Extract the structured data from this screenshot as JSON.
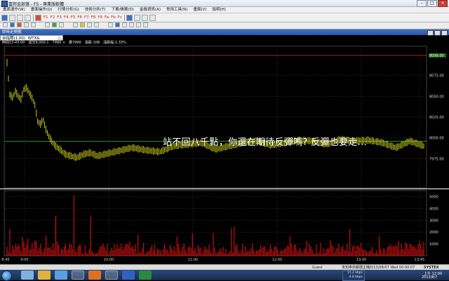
{
  "window": {
    "title": "富邦金部落 - FS - 專業版軟體"
  },
  "menu": [
    "畫面運作(W)",
    "畫面操作(Q)",
    "行情分析(G)",
    "技術分析(T)",
    "下單/帳務(D)",
    "金融資訊(A)",
    "常用工具(N)",
    "畫面(V)",
    "說明(H)"
  ],
  "fkeys": [
    "F1",
    "F2",
    "F3",
    "F4",
    "F5",
    "F6",
    "F7",
    "F8",
    "F9",
    "Fa",
    "Fb",
    "Fc"
  ],
  "chart_window": {
    "title": "即時走勢圖",
    "symbol": "台指期(1.00)",
    "symbol_code": "WTX&",
    "info": "時間13:43:00　成交8,000.1　7990 +　量7990　漲跌-108　漲跌幅-1.33%"
  },
  "overlay": {
    "caption": "站不回八千點，你還在期待反彈嗎? 反彈也要走..."
  },
  "status": {
    "user": "Guest",
    "server": "未知券商報價主機",
    "datetime": "2013/08/07 Wed 00:00:07",
    "brand": "SYSTEX"
  },
  "tray": {
    "time": "上午 12:00",
    "date": "2013/8/7",
    "net_up": "15.2 kbps",
    "net_down": "4.8 kbps"
  },
  "chart_data": {
    "type": "line",
    "price": {
      "ylim": [
        7940,
        8110
      ],
      "yticks": [
        8075,
        8050,
        8025,
        8000,
        7975
      ],
      "ytick_labels": [
        "8075.00",
        "8050.00",
        "8025.00",
        "8000.00",
        "7975.00"
      ],
      "ref_lines": {
        "upper": 8099,
        "reference": 7996
      },
      "last_label": "8099.00",
      "x": [
        0,
        2,
        4,
        6,
        8,
        10,
        12,
        14,
        16,
        18,
        20,
        22,
        24,
        26,
        28,
        30,
        32,
        35,
        38,
        42,
        46,
        50,
        55,
        60,
        65,
        70,
        80,
        90,
        100,
        110,
        120,
        130,
        140,
        150,
        160,
        170,
        180,
        190,
        200,
        210,
        220,
        230,
        240,
        250,
        260,
        270,
        280,
        290,
        300
      ],
      "values": [
        8090,
        8052,
        8048,
        8056,
        8050,
        8046,
        8058,
        8060,
        8054,
        8048,
        8040,
        8020,
        8016,
        8022,
        8010,
        8002,
        7996,
        7990,
        7986,
        7980,
        7978,
        7976,
        7980,
        7982,
        7978,
        7980,
        7984,
        7988,
        7985,
        7983,
        7990,
        7992,
        7994,
        7986,
        7990,
        7994,
        7996,
        7991,
        7994,
        7997,
        7996,
        7992,
        7998,
        7996,
        7997,
        7994,
        7988,
        7996,
        7990
      ]
    },
    "volume": {
      "yticks": [
        5000,
        4000,
        3000,
        2000,
        1000
      ],
      "ytick_labels": [
        "5000",
        "4000",
        "3000",
        "2000",
        "1000"
      ],
      "ylim": [
        0,
        5500
      ]
    },
    "xticks": [
      "8:45",
      "9:00",
      "10:00",
      "11:00",
      "12:00",
      "13:00",
      "13:45"
    ]
  },
  "colors": {
    "up": "#e0e020",
    "grid": "#5a5a5a",
    "volume": "#dd1010",
    "ref": "#c82020",
    "green_ref": "#30a030"
  }
}
